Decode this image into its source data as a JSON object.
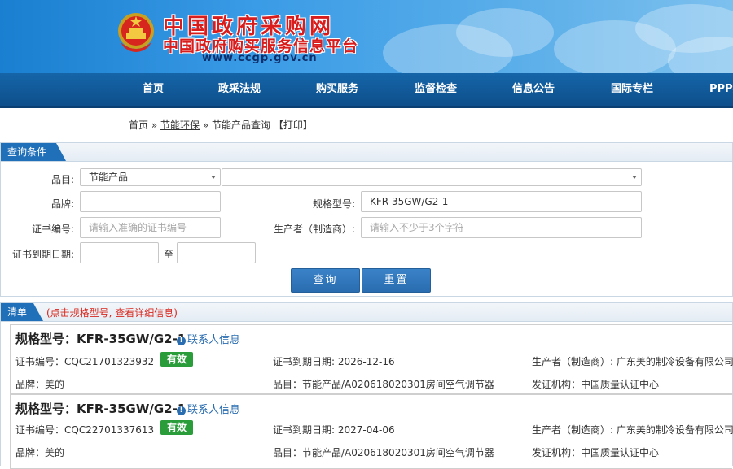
{
  "header": {
    "site_title": "中国政府采购网",
    "site_subtitle": "中国政府购买服务信息平台",
    "site_url": "www.ccgp.gov.cn"
  },
  "nav": {
    "items": [
      "首页",
      "政采法规",
      "购买服务",
      "监督检查",
      "信息公告",
      "国际专栏",
      "PPP频"
    ]
  },
  "breadcrumb": {
    "home": "首页",
    "sep1": "»",
    "energy": "节能环保",
    "sep2": "»",
    "current": "节能产品查询",
    "print": "【打印】"
  },
  "query": {
    "tab_label": "查询条件",
    "category_label": "品目:",
    "category_value": "节能产品",
    "subcategory_value": "",
    "brand_label": "品牌:",
    "brand_value": "",
    "model_label": "规格型号:",
    "model_value": "KFR-35GW/G2-1",
    "cert_no_label": "证书编号:",
    "cert_no_placeholder": "请输入准确的证书编号",
    "manufacturer_label": "生产者（制造商）:",
    "manufacturer_placeholder": "请输入不少于3个字符",
    "expiry_label": "证书到期日期:",
    "expiry_from": "",
    "expiry_to_label": "至",
    "expiry_to": "",
    "search_button": "查询",
    "reset_button": "重置"
  },
  "results": {
    "tab_label": "清单",
    "hint": "(点击规格型号, 查看详细信息)",
    "items": [
      {
        "title": "规格型号：KFR-35GW/G2-1",
        "contact_link": "联系人信息",
        "cert_no": "证书编号：CQC21701323932",
        "status": "有效",
        "expiry": "证书到期日期: 2026-12-16",
        "manufacturer": "生产者（制造商）: 广东美的制冷设备有限公司",
        "brand": "品牌：美的",
        "category": "品目：节能产品/A020618020301房间空气调节器",
        "issuer": "发证机构：中国质量认证中心"
      },
      {
        "title": "规格型号：KFR-35GW/G2-1",
        "contact_link": "联系人信息",
        "cert_no": "证书编号：CQC22701337613",
        "status": "有效",
        "expiry": "证书到期日期: 2027-04-06",
        "manufacturer": "生产者（制造商）: 广东美的制冷设备有限公司",
        "brand": "品牌：美的",
        "category": "品目：节能产品/A020618020301房间空气调节器",
        "issuer": "发证机构：中国质量认证中心"
      }
    ]
  },
  "colors": {
    "nav_bg": "#1565a8",
    "accent_blue": "#1f6fb9",
    "title_red": "#d91c1c",
    "status_green": "#2a9d3a",
    "hint_red": "#d9261c"
  }
}
